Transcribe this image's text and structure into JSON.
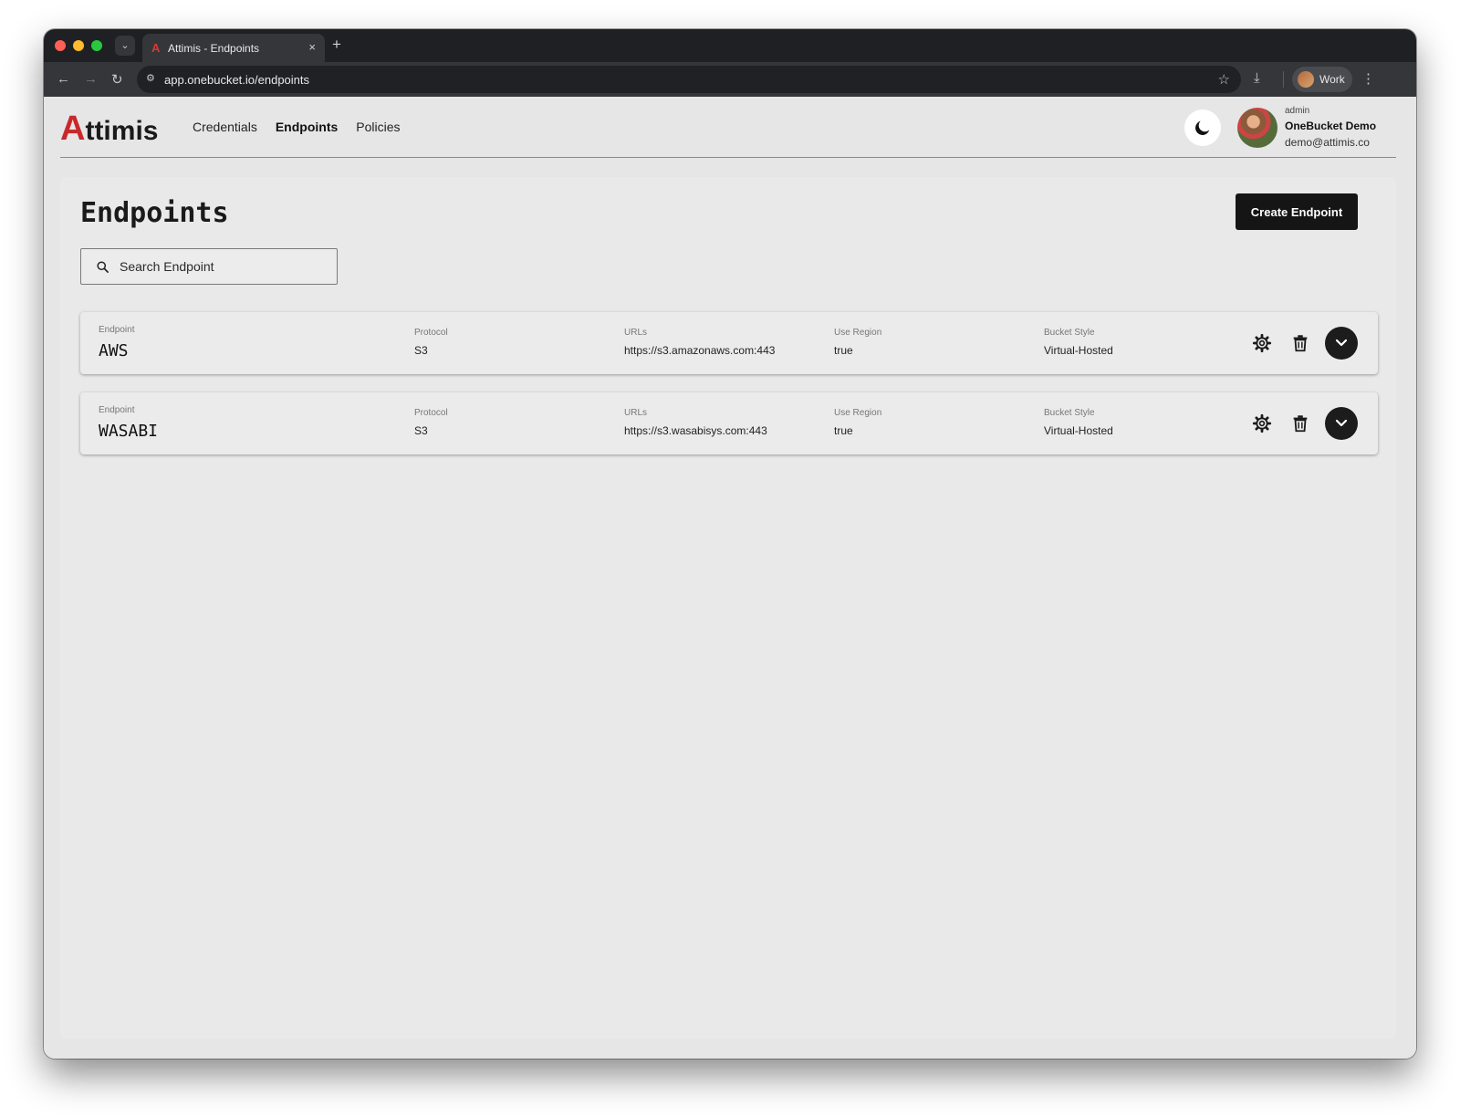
{
  "browser": {
    "tab_title": "Attimis - Endpoints",
    "tab_favicon": "A",
    "tab_close": "×",
    "new_tab": "+",
    "tab_search_icon": "⌄",
    "url": "app.onebucket.io/endpoints",
    "site_settings_icon": "⚙",
    "back_icon": "←",
    "forward_icon": "→",
    "reload_icon": "↻",
    "bookmark_icon": "☆",
    "download_icon": "⤓",
    "menu_icon": "⋮",
    "profile_name": "Work"
  },
  "header": {
    "logo_initial": "A",
    "logo_rest": "ttimis",
    "nav": [
      {
        "label": "Credentials",
        "active": false
      },
      {
        "label": "Endpoints",
        "active": true
      },
      {
        "label": "Policies",
        "active": false
      }
    ],
    "theme_toggle_icon": "moon-icon",
    "user": {
      "role": "admin",
      "name": "OneBucket Demo",
      "email": "demo@attimis.co"
    }
  },
  "page": {
    "title": "Endpoints",
    "create_button": "Create Endpoint",
    "search_placeholder": "Search Endpoint"
  },
  "columns": {
    "endpoint": "Endpoint",
    "protocol": "Protocol",
    "urls": "URLs",
    "use_region": "Use Region",
    "bucket_style": "Bucket Style"
  },
  "endpoints": [
    {
      "name": "AWS",
      "protocol": "S3",
      "url": "https://s3.amazonaws.com:443",
      "use_region": "true",
      "bucket_style": "Virtual-Hosted"
    },
    {
      "name": "WASABI",
      "protocol": "S3",
      "url": "https://s3.wasabisys.com:443",
      "use_region": "true",
      "bucket_style": "Virtual-Hosted"
    }
  ],
  "colors": {
    "brand_red": "#c8292b",
    "primary_button": "#151515"
  }
}
